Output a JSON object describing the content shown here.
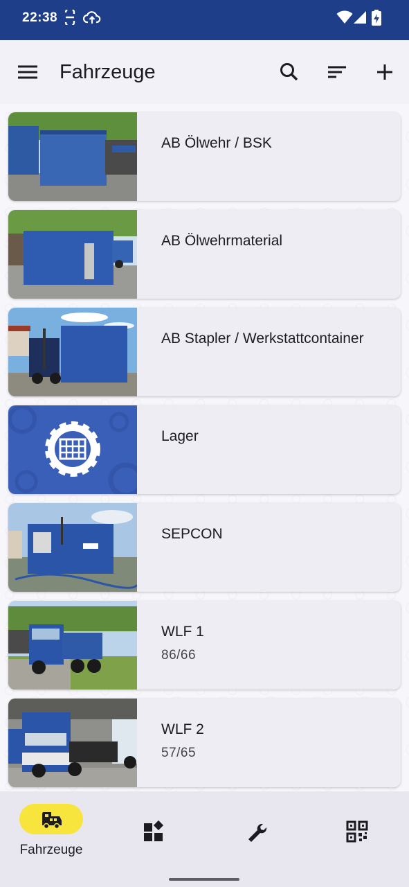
{
  "status_bar": {
    "time": "22:38"
  },
  "app_bar": {
    "title": "Fahrzeuge"
  },
  "vehicles": [
    {
      "title": "AB Ölwehr / BSK",
      "subtitle": ""
    },
    {
      "title": "AB Ölwehrmaterial",
      "subtitle": ""
    },
    {
      "title": "AB Stapler / Werkstattcontainer",
      "subtitle": ""
    },
    {
      "title": "Lager",
      "subtitle": ""
    },
    {
      "title": "SEPCON",
      "subtitle": ""
    },
    {
      "title": "WLF 1",
      "subtitle": "86/66"
    },
    {
      "title": "WLF 2",
      "subtitle": "57/65"
    }
  ],
  "bottom_nav": {
    "items": [
      {
        "label": "Fahrzeuge",
        "icon": "truck-icon",
        "selected": true
      },
      {
        "label": "",
        "icon": "widgets-icon",
        "selected": false
      },
      {
        "label": "",
        "icon": "wrench-icon",
        "selected": false
      },
      {
        "label": "",
        "icon": "qr-code-icon",
        "selected": false
      }
    ]
  },
  "colors": {
    "status_bar": "#1e3e8a",
    "nav_selected_pill": "#f7e43c",
    "thw_blue": "#2a4ea8"
  }
}
